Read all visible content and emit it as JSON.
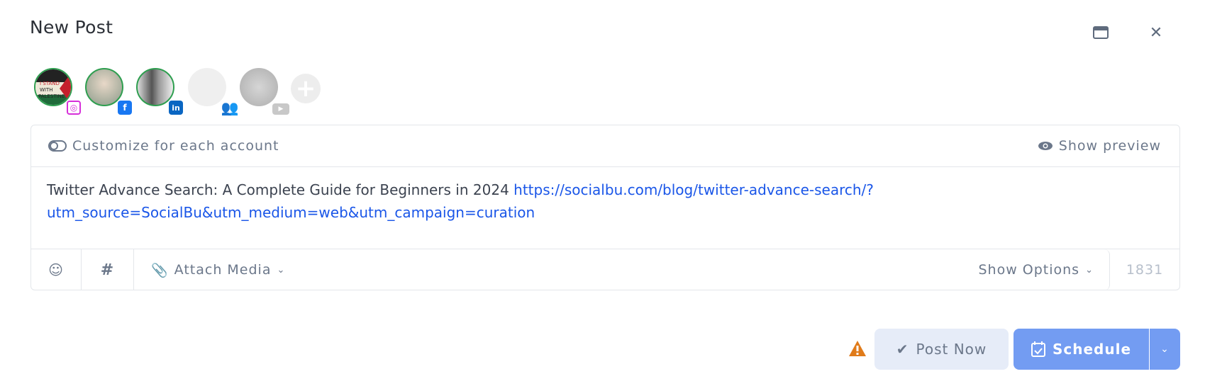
{
  "dialog": {
    "title": "New Post"
  },
  "accounts": [
    {
      "name": "I STAND WITH PALESTINE",
      "network": "instagram",
      "selected": true
    },
    {
      "network": "facebook",
      "selected": true
    },
    {
      "network": "linkedin",
      "selected": true
    },
    {
      "network": "group",
      "selected": false
    },
    {
      "network": "youtube",
      "selected": false
    }
  ],
  "avatar_text": "I STAND WITH PALESTINE",
  "toolbar": {
    "customize_label": "Customize for each account",
    "preview_label": "Show preview"
  },
  "post": {
    "text": "Twitter Advance Search: A Complete Guide for Beginners in 2024 ",
    "link": "https://socialbu.com/blog/twitter-advance-search/?utm_source=SocialBu&utm_medium=web&utm_campaign=curation"
  },
  "bottombar": {
    "attach_label": "Attach Media",
    "options_label": "Show Options",
    "char_count": "1831"
  },
  "actions": {
    "post_now": "Post Now",
    "schedule": "Schedule"
  },
  "colors": {
    "primary": "#739cf2",
    "secondary": "#e6ecf8",
    "warning": "#e07b1a",
    "link": "#1a56e8"
  }
}
